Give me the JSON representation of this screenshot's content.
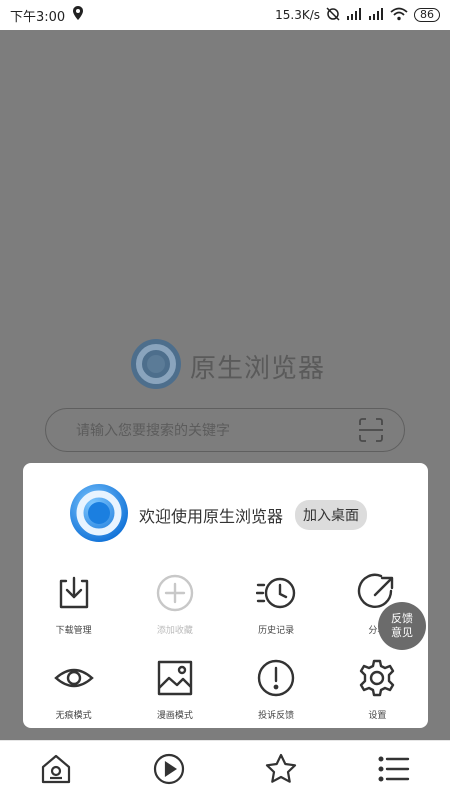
{
  "status_bar": {
    "time": "下午3:00",
    "network_speed": "15.3K/s",
    "battery": "86"
  },
  "home": {
    "brand_name": "原生浏览器",
    "search_placeholder": "请输入您要搜索的关键字"
  },
  "popup": {
    "welcome_text": "欢迎使用原生浏览器",
    "add_to_desktop_label": "加入桌面",
    "items": [
      {
        "label": "下载管理",
        "icon": "download-icon",
        "enabled": true
      },
      {
        "label": "添加收藏",
        "icon": "add-favorite-icon",
        "enabled": false
      },
      {
        "label": "历史记录",
        "icon": "history-icon",
        "enabled": true
      },
      {
        "label": "分享",
        "icon": "share-icon",
        "enabled": true
      },
      {
        "label": "无痕模式",
        "icon": "incognito-eye-icon",
        "enabled": true
      },
      {
        "label": "漫画模式",
        "icon": "comic-image-icon",
        "enabled": true
      },
      {
        "label": "投诉反馈",
        "icon": "complaint-icon",
        "enabled": true
      },
      {
        "label": "设置",
        "icon": "settings-gear-icon",
        "enabled": true
      }
    ]
  },
  "feedback_float": {
    "line1": "反馈",
    "line2": "意见"
  },
  "bottom_nav": [
    "home-icon",
    "play-icon",
    "star-icon",
    "menu-icon"
  ]
}
